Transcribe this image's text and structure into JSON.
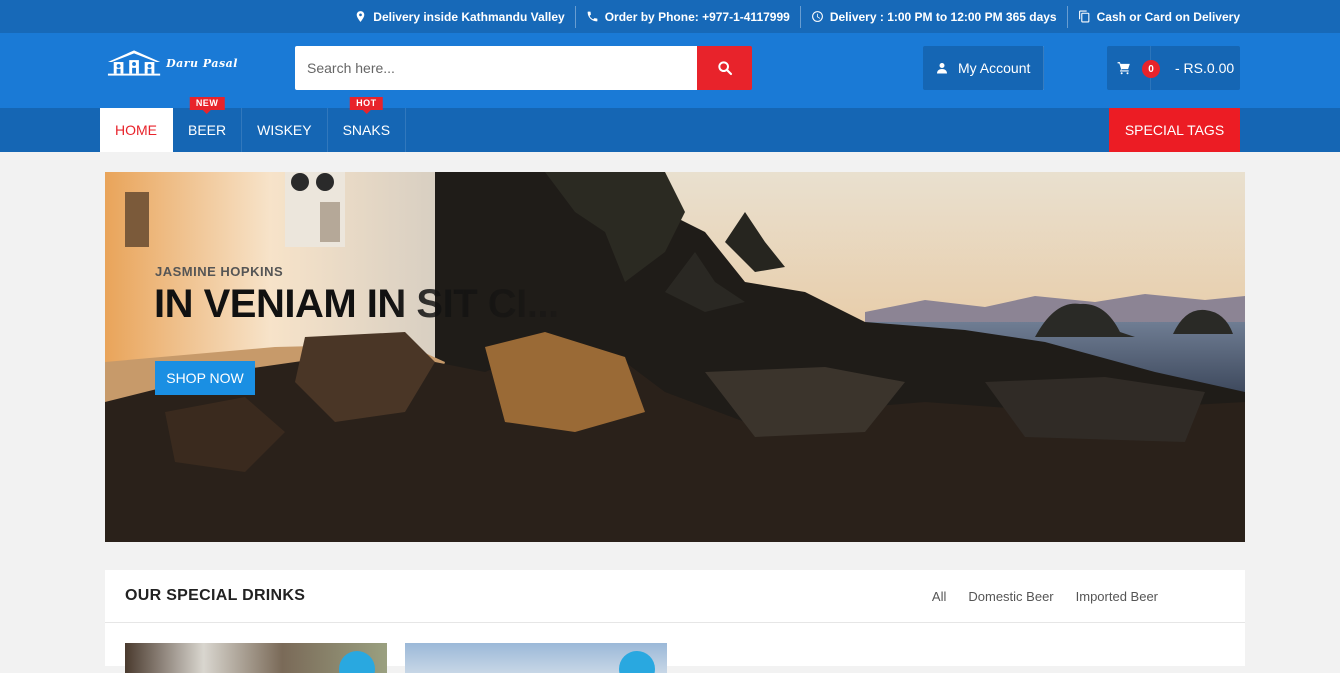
{
  "topbar": {
    "items": [
      {
        "icon": "map-pin-icon",
        "label": "Delivery inside Kathmandu Valley"
      },
      {
        "icon": "phone-icon",
        "label": "Order by Phone: +977-1-4117999"
      },
      {
        "icon": "clock-icon",
        "label": "Delivery : 1:00 PM to 12:00 PM 365 days"
      },
      {
        "icon": "copy-icon",
        "label": "Cash or Card on Delivery"
      }
    ]
  },
  "header": {
    "logo_text": "Daru Pasal",
    "search": {
      "placeholder": "Search here...",
      "value": ""
    },
    "account_label": "My Account",
    "cart": {
      "count": "0",
      "total": "- RS.0.00"
    }
  },
  "nav": {
    "items": [
      {
        "label": "HOME",
        "badge": ""
      },
      {
        "label": "BEER",
        "badge": "NEW"
      },
      {
        "label": "WISKEY",
        "badge": ""
      },
      {
        "label": "SNAKS",
        "badge": "HOT"
      }
    ],
    "special": "SPECIAL TAGS"
  },
  "hero": {
    "subtitle": "JASMINE HOPKINS",
    "title": "IN VENIAM IN SIT CI...",
    "button": "SHOP NOW"
  },
  "drinks": {
    "title": "OUR SPECIAL DRINKS",
    "tabs": [
      "All",
      "Domestic Beer",
      "Imported Beer"
    ]
  },
  "colors": {
    "topbar": "#1769b8",
    "header": "#1a7ad6",
    "accent_red": "#e8232b",
    "button_blue": "#1a8fe3"
  }
}
